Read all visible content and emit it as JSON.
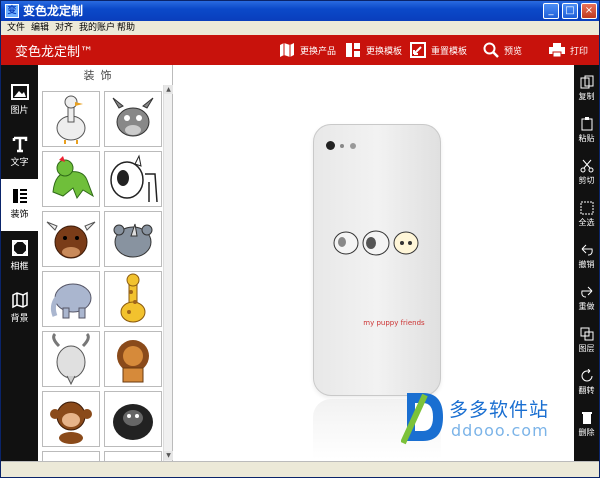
{
  "window": {
    "title": "变色龙定制",
    "app_icon": "变",
    "buttons": [
      "_",
      "□",
      "×"
    ]
  },
  "menu": [
    "文件",
    "编辑",
    "对齐",
    "我的账户",
    "帮助"
  ],
  "toolbar": {
    "brand": "变色龙定制™",
    "buttons": [
      {
        "label": "更换产品",
        "icon": "map-icon"
      },
      {
        "label": "更换模板",
        "icon": "template-icon"
      },
      {
        "label": "重置模板",
        "icon": "reset-icon"
      },
      {
        "label": "预览",
        "icon": "search-icon"
      },
      {
        "label": "打印",
        "icon": "printer-icon"
      }
    ]
  },
  "left_tools": [
    {
      "label": "图片",
      "icon": "image-icon",
      "active": false
    },
    {
      "label": "文字",
      "icon": "text-icon",
      "active": false
    },
    {
      "label": "装饰",
      "icon": "decoration-icon",
      "active": true
    },
    {
      "label": "相框",
      "icon": "frame-icon",
      "active": false
    },
    {
      "label": "背景",
      "icon": "background-icon",
      "active": false
    }
  ],
  "panel": {
    "title": "装饰",
    "items": [
      "goose",
      "donkey",
      "dinosaur",
      "dog",
      "bull",
      "rhino",
      "elephant",
      "giraffe",
      "goat",
      "lion",
      "monkey",
      "gorilla"
    ]
  },
  "canvas": {
    "design_text": "my puppy friends",
    "watermark_cn": "多多软件站",
    "watermark_en": "ddooo.com"
  },
  "right_tools": [
    {
      "label": "复制",
      "icon": "copy-icon"
    },
    {
      "label": "粘贴",
      "icon": "paste-icon"
    },
    {
      "label": "剪切",
      "icon": "scissors-icon"
    },
    {
      "label": "全选",
      "icon": "select-all-icon"
    },
    {
      "label": "撤销",
      "icon": "undo-icon"
    },
    {
      "label": "重做",
      "icon": "redo-icon"
    },
    {
      "label": "图层",
      "icon": "layers-icon"
    },
    {
      "label": "翻转",
      "icon": "flip-icon"
    },
    {
      "label": "删除",
      "icon": "trash-icon"
    }
  ],
  "colors": {
    "toolbar_red": "#c8120c",
    "sidebar_black": "#111111",
    "titlebar_blue": "#0b49c9",
    "watermark_blue": "#1a6fd1"
  }
}
